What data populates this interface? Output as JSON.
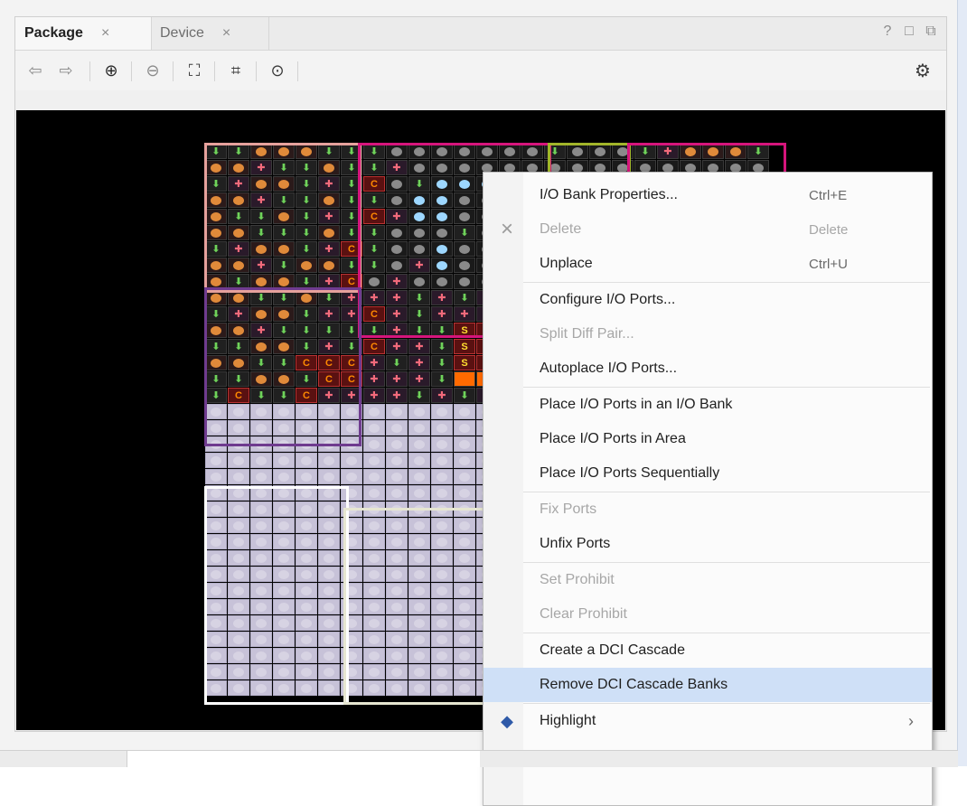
{
  "tabs": [
    {
      "label": "Package",
      "close": "×"
    },
    {
      "label": "Device",
      "close": "×"
    }
  ],
  "window_controls": [
    "?",
    "□",
    "⧉"
  ],
  "toolbar": {
    "back_icon": "arrow-left-icon",
    "forward_icon": "arrow-right-icon",
    "zoom_in_icon": "zoom-in-icon",
    "zoom_out_icon": "zoom-out-icon",
    "fit_icon": "fit-view-icon",
    "zoom_area_icon": "zoom-area-icon",
    "center_icon": "crosshair-icon",
    "settings_icon": "gear-icon"
  },
  "grid": {
    "rows": [
      [
        "g",
        "g",
        "o",
        "o",
        "o",
        "g",
        "g",
        "g",
        "gry",
        "gry",
        "gry",
        "gry",
        "gry",
        "gry",
        "gry",
        "g",
        "gry",
        "gry",
        "gry",
        "g",
        "p",
        "o",
        "o",
        "o",
        "g"
      ],
      [
        "o",
        "o",
        "p",
        "g",
        "g",
        "o",
        "g",
        "g",
        "p",
        "gry",
        "gry",
        "gry",
        "gry",
        "gry",
        "gry",
        "gry",
        "gry",
        "gry",
        "gry",
        "gry",
        "gry",
        "gry",
        "gry",
        "gry",
        "gry"
      ],
      [
        "g",
        "p",
        "o",
        "o",
        "g",
        "p",
        "g",
        "c",
        "gry",
        "g",
        "blu",
        "blu",
        "blu",
        "gry",
        "gry",
        "gry",
        "gry",
        "gry",
        "gry",
        "gry",
        "gry",
        "gry",
        "gry",
        "gry",
        "gry"
      ],
      [
        "o",
        "o",
        "p",
        "g",
        "g",
        "o",
        "g",
        "g",
        "gry",
        "blu",
        "blu",
        "gry",
        "gry",
        "gry",
        "gry",
        "gry",
        "gry",
        "gry",
        "gry",
        "gry",
        "gry",
        "gry",
        "gry",
        "gry",
        "gry"
      ],
      [
        "o",
        "g",
        "g",
        "o",
        "g",
        "p",
        "g",
        "c",
        "p",
        "blu",
        "blu",
        "gry",
        "gry",
        "gry",
        "gry",
        "gry",
        "gry",
        "gry",
        "gry",
        "gry",
        "gry",
        "gry",
        "gry",
        "gry",
        "gry"
      ],
      [
        "o",
        "o",
        "g",
        "g",
        "g",
        "o",
        "g",
        "g",
        "gry",
        "gry",
        "gry",
        "g",
        "gry",
        "gry",
        "gry",
        "gry",
        "gry",
        "gry",
        "gry",
        "gry",
        "gry",
        "gry",
        "gry",
        "gry",
        "gry"
      ],
      [
        "g",
        "p",
        "o",
        "o",
        "g",
        "p",
        "c",
        "g",
        "gry",
        "gry",
        "blu",
        "gry",
        "gry",
        "gry",
        "gry",
        "gry",
        "gry",
        "gry",
        "gry",
        "gry",
        "gry",
        "gry",
        "gry",
        "gry",
        "gry"
      ],
      [
        "o",
        "o",
        "p",
        "g",
        "o",
        "o",
        "g",
        "g",
        "gry",
        "p",
        "blu",
        "gry",
        "gry",
        "gry",
        "gry",
        "gry",
        "gry",
        "gry",
        "gry",
        "gry",
        "gry",
        "gry",
        "gry",
        "gry",
        "gry"
      ],
      [
        "o",
        "g",
        "o",
        "o",
        "g",
        "p",
        "c",
        "gry",
        "p",
        "gry",
        "gry",
        "gry",
        "gry",
        "gry",
        "gry",
        "gry",
        "gry",
        "gry",
        "gry",
        "gry",
        "gry",
        "gry",
        "gry",
        "gry",
        "gry"
      ],
      [
        "o",
        "o",
        "g",
        "g",
        "o",
        "g",
        "p",
        "p",
        "p",
        "g",
        "p",
        "g",
        "p",
        "gry",
        "gry",
        "gry",
        "gry",
        "gry",
        "gry",
        "gry",
        "gry",
        "gry",
        "gry",
        "gry",
        "gry"
      ],
      [
        "g",
        "p",
        "o",
        "o",
        "g",
        "p",
        "p",
        "c",
        "p",
        "g",
        "p",
        "p",
        "p",
        "gry",
        "gry",
        "gry",
        "gry",
        "gry",
        "gry",
        "gry",
        "gry",
        "gry",
        "gry",
        "gry",
        "gry"
      ],
      [
        "o",
        "o",
        "p",
        "g",
        "g",
        "g",
        "g",
        "g",
        "p",
        "g",
        "g",
        "s",
        "s",
        "gry",
        "gry",
        "gry",
        "gry",
        "gry",
        "gry",
        "gry",
        "gry",
        "gry",
        "gry",
        "gry",
        "gry"
      ],
      [
        "g",
        "g",
        "o",
        "o",
        "g",
        "p",
        "g",
        "c",
        "p",
        "p",
        "g",
        "s",
        "s",
        "gry",
        "gry",
        "gry",
        "gry",
        "gry",
        "gry",
        "gry",
        "gry",
        "gry",
        "gry",
        "gry",
        "gry"
      ],
      [
        "o",
        "o",
        "g",
        "g",
        "c",
        "c",
        "c",
        "p",
        "g",
        "p",
        "g",
        "s",
        "s",
        "gry",
        "gry",
        "gry",
        "gry",
        "gry",
        "gry",
        "gry",
        "gry",
        "gry",
        "gry",
        "gry",
        "gry"
      ],
      [
        "g",
        "g",
        "o",
        "o",
        "g",
        "c",
        "c",
        "p",
        "p",
        "p",
        "g",
        "or",
        "or",
        "gry",
        "gry",
        "gry",
        "gry",
        "gry",
        "gry",
        "gry",
        "gry",
        "gry",
        "gry",
        "gry",
        "gry"
      ],
      [
        "g",
        "c",
        "g",
        "g",
        "c",
        "p",
        "p",
        "p",
        "p",
        "g",
        "p",
        "g",
        "p",
        "gry",
        "gry",
        "gry",
        "gry",
        "gry",
        "gry",
        "gry",
        "gry",
        "gry",
        "gry",
        "gry",
        "gry"
      ],
      [
        "lt",
        "lt",
        "lt",
        "lt",
        "lt",
        "lt",
        "lt",
        "lt",
        "lt",
        "lt",
        "lt",
        "lt",
        "lt",
        "lg",
        "lg",
        "lg",
        "lg",
        "lg",
        "lg",
        "lg",
        "lg",
        "lg",
        "lg",
        "lg",
        "lg"
      ],
      [
        "lt",
        "lt",
        "lt",
        "lt",
        "lt",
        "lt",
        "lt",
        "lt",
        "lt",
        "lt",
        "lt",
        "lt",
        "lt",
        "lg",
        "lg",
        "lg",
        "lg",
        "lg",
        "lg",
        "lg",
        "lg",
        "lg",
        "lg",
        "lg",
        "lg"
      ],
      [
        "lt",
        "lt",
        "lt",
        "lt",
        "lt",
        "lt",
        "lt",
        "lt",
        "lt",
        "lt",
        "lt",
        "lt",
        "lt",
        "lg",
        "lg",
        "lg",
        "lg",
        "lg",
        "lg",
        "lg",
        "lg",
        "lg",
        "lg",
        "lg",
        "lg"
      ],
      [
        "lt",
        "lt",
        "lt",
        "lt",
        "lt",
        "lt",
        "lt",
        "lt",
        "lt",
        "lt",
        "lt",
        "lt",
        "lt",
        "lg",
        "lg",
        "lg",
        "lg",
        "lg",
        "lg",
        "lg",
        "lg",
        "lg",
        "lg",
        "lg",
        "lg"
      ],
      [
        "lt",
        "lt",
        "lt",
        "lt",
        "lt",
        "lt",
        "lt",
        "lt",
        "lt",
        "lt",
        "lt",
        "lt",
        "lt",
        "lg",
        "lg",
        "lg",
        "lg",
        "lg",
        "lg",
        "lg",
        "lg",
        "lg",
        "lg",
        "lg",
        "lg"
      ],
      [
        "lt",
        "lt",
        "lt",
        "lt",
        "lt",
        "lt",
        "lt",
        "lt",
        "lt",
        "lt",
        "lt",
        "lt",
        "lt",
        "lg",
        "lg",
        "lg",
        "lg",
        "lg",
        "lg",
        "lg",
        "lg",
        "lg",
        "lg",
        "lg",
        "lg"
      ],
      [
        "lt",
        "lt",
        "lt",
        "lt",
        "lt",
        "lt",
        "lt",
        "lt",
        "lt",
        "lt",
        "lt",
        "lt",
        "lt",
        "lg",
        "lg",
        "lg",
        "lg",
        "lg",
        "lg",
        "lg",
        "lg",
        "lg",
        "lg",
        "lg",
        "lg"
      ],
      [
        "lt",
        "lt",
        "lt",
        "lt",
        "lt",
        "lt",
        "lt",
        "lt",
        "lt",
        "lt",
        "lt",
        "lt",
        "lt",
        "lg",
        "lg",
        "lg",
        "lg",
        "lg",
        "lg",
        "lg",
        "lg",
        "lg",
        "lg",
        "lg",
        "lg"
      ],
      [
        "lt",
        "lt",
        "lt",
        "lt",
        "lt",
        "lt",
        "lt",
        "lt",
        "lt",
        "lt",
        "lt",
        "lt",
        "lt",
        "lg",
        "lg",
        "lg",
        "lg",
        "lg",
        "lg",
        "lg",
        "lg",
        "lg",
        "lg",
        "lg",
        "lg"
      ],
      [
        "lt",
        "lt",
        "lt",
        "lt",
        "lt",
        "lt",
        "lt",
        "lt",
        "lt",
        "lt",
        "lt",
        "lt",
        "lt",
        "lg",
        "lg",
        "lg",
        "lg",
        "lg",
        "lg",
        "lg",
        "lg",
        "lg",
        "lg",
        "lg",
        "lg"
      ],
      [
        "lt",
        "lt",
        "lt",
        "lt",
        "lt",
        "lt",
        "lt",
        "lt",
        "lt",
        "lt",
        "lt",
        "lt",
        "lt",
        "lg",
        "lg",
        "lg",
        "lg",
        "lg",
        "lg",
        "lg",
        "lg",
        "lg",
        "lg",
        "lg",
        "lg"
      ],
      [
        "lt",
        "lt",
        "lt",
        "lt",
        "lt",
        "lt",
        "lt",
        "lt",
        "lt",
        "lt",
        "lt",
        "lt",
        "lt",
        "lg",
        "lg",
        "lg",
        "lg",
        "lg",
        "lg",
        "lg",
        "lg",
        "lg",
        "lg",
        "lg",
        "lg"
      ],
      [
        "lt",
        "lt",
        "lt",
        "lt",
        "lt",
        "lt",
        "lt",
        "lt",
        "lt",
        "lt",
        "lt",
        "lt",
        "lt",
        "lg",
        "lg",
        "lg",
        "lg",
        "lg",
        "lg",
        "lg",
        "lg",
        "lg",
        "lg",
        "lg",
        "lg"
      ],
      [
        "lt",
        "lt",
        "lt",
        "lt",
        "lt",
        "lt",
        "lt",
        "lt",
        "lt",
        "lt",
        "lt",
        "lt",
        "lt",
        "lg",
        "lg",
        "lg",
        "lg",
        "lg",
        "lg",
        "lg",
        "lg",
        "lg",
        "lg",
        "lg",
        "lg"
      ],
      [
        "lt",
        "lt",
        "lt",
        "lt",
        "lt",
        "lt",
        "lt",
        "lt",
        "lt",
        "lt",
        "lt",
        "lt",
        "lt",
        "lg",
        "lg",
        "lg",
        "lg",
        "lg",
        "lg",
        "lg",
        "lg",
        "lg",
        "lg",
        "lg",
        "lg"
      ],
      [
        "lt",
        "lt",
        "lt",
        "lt",
        "lt",
        "lt",
        "lt",
        "lt",
        "lt",
        "lt",
        "lt",
        "lt",
        "lt",
        "lg",
        "lg",
        "lg",
        "lg",
        "lg",
        "lg",
        "lg",
        "lg",
        "lg",
        "lg",
        "lg",
        "lg"
      ],
      [
        "lt",
        "lt",
        "lt",
        "lt",
        "lt",
        "lt",
        "lt",
        "lt",
        "lt",
        "lt",
        "lt",
        "lt",
        "lt",
        "lg",
        "lg",
        "lg",
        "lg",
        "lg",
        "lg",
        "lg",
        "lg",
        "lg",
        "lg",
        "lg",
        "lg"
      ],
      [
        "lt",
        "lt",
        "lt",
        "lt",
        "lt",
        "lt",
        "lt",
        "lt",
        "lt",
        "lt",
        "lt",
        "lt",
        "lt",
        "lg",
        "lg",
        "lg",
        "lg",
        "lg",
        "lg",
        "lg",
        "lg",
        "lg",
        "lg",
        "lg",
        "lg"
      ]
    ],
    "glyphs": {
      "g": "⬇",
      "p": "✚",
      "c": "C",
      "s": "S"
    }
  },
  "menu": {
    "items": [
      {
        "label": "I/O Bank Properties...",
        "shortcut": "Ctrl+E",
        "disabled": false
      },
      {
        "label": "Delete",
        "shortcut": "Delete",
        "disabled": true,
        "icon": "×"
      },
      {
        "label": "Unplace",
        "shortcut": "Ctrl+U",
        "disabled": false
      },
      {
        "label": "Configure I/O Ports...",
        "shortcut": "",
        "disabled": false
      },
      {
        "label": "Split Diff Pair...",
        "shortcut": "",
        "disabled": true
      },
      {
        "label": "Autoplace I/O Ports...",
        "shortcut": "",
        "disabled": false
      },
      {
        "label": "Place I/O Ports in an I/O Bank",
        "shortcut": "",
        "disabled": false
      },
      {
        "label": "Place I/O Ports in Area",
        "shortcut": "",
        "disabled": false
      },
      {
        "label": "Place I/O Ports Sequentially",
        "shortcut": "",
        "disabled": false
      },
      {
        "label": "Fix Ports",
        "shortcut": "",
        "disabled": true
      },
      {
        "label": "Unfix Ports",
        "shortcut": "",
        "disabled": false
      },
      {
        "label": "Set Prohibit",
        "shortcut": "",
        "disabled": true
      },
      {
        "label": "Clear Prohibit",
        "shortcut": "",
        "disabled": true
      },
      {
        "label": "Create a DCI Cascade",
        "shortcut": "",
        "disabled": false
      },
      {
        "label": "Remove DCI Cascade Banks",
        "shortcut": "",
        "disabled": false,
        "highlighted": true
      },
      {
        "label": "Highlight",
        "shortcut": "",
        "disabled": false,
        "submenu": true
      }
    ]
  }
}
